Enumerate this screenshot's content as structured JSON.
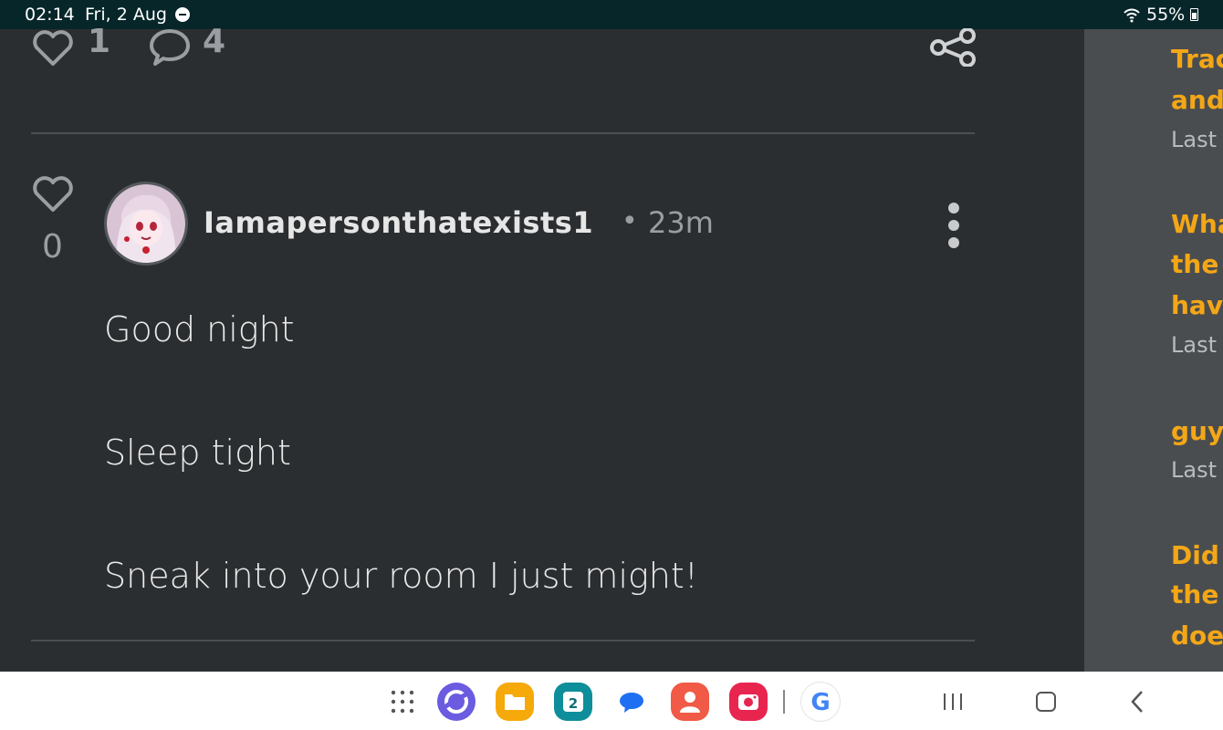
{
  "status_bar": {
    "time": "02:14",
    "date": "Fri, 2 Aug",
    "battery": "55%"
  },
  "post_actions": {
    "likes": "1",
    "comments": "4"
  },
  "comment": {
    "votes": "0",
    "username": "Iamapersonthatexists1",
    "separator": "•",
    "time_ago": "23m",
    "lines": [
      "Good night",
      "Sleep tight",
      "Sneak into your room I just might!"
    ]
  },
  "sidebar": {
    "threads": [
      {
        "title_lines": [
          "Trac",
          "and"
        ],
        "meta": "Last"
      },
      {
        "title_lines": [
          "Wha",
          "the",
          "hav"
        ],
        "meta": "Last"
      },
      {
        "title_lines": [
          "guy"
        ],
        "meta": "Last"
      },
      {
        "title_lines": [
          "Did",
          "the",
          "doe"
        ],
        "meta": "Last"
      }
    ]
  },
  "nav_bar": {
    "apps": [
      "app-drawer",
      "internet",
      "my-files",
      "calendar",
      "messages",
      "contacts",
      "camera",
      "google"
    ],
    "calendar_day": "2",
    "google_letter": "G"
  },
  "colors": {
    "accent": "#f4a716",
    "background": "#2b2e30",
    "sidebar": "#4a4d50",
    "status_bar": "#072629"
  }
}
